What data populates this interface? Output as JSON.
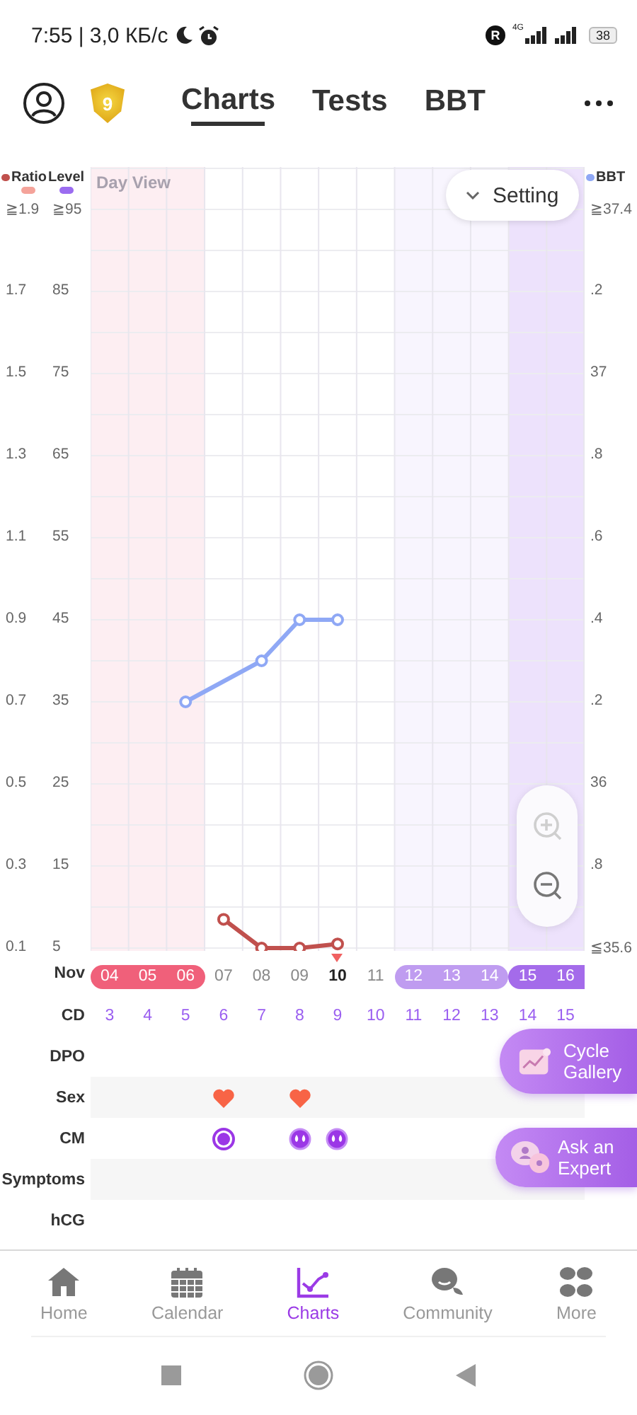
{
  "status_bar": {
    "time": "7:55 | 3,0 КБ/с",
    "indicator": "R",
    "network": "4G",
    "battery": "38"
  },
  "header": {
    "badge": "9",
    "tabs": [
      {
        "label": "Charts",
        "selected": true
      },
      {
        "label": "Tests",
        "selected": false
      },
      {
        "label": "BBT",
        "selected": false
      }
    ]
  },
  "legend": {
    "ratio_light": {
      "color": "#f4a39a"
    },
    "level": {
      "label": "Level",
      "color": "#9b6cf0"
    }
  },
  "chart": {
    "view_label": "Day View",
    "setting_button": "Setting",
    "zoom_in_disabled": true,
    "level_ticks": [
      "≧95",
      "85",
      "75",
      "65",
      "55",
      "45",
      "35",
      "25",
      "15",
      "5"
    ],
    "chart_data": {
      "type": "line",
      "grid": true,
      "legend": "top",
      "categories": [
        "04",
        "05",
        "06",
        "07",
        "08",
        "09",
        "10",
        "11",
        "12",
        "13",
        "14",
        "15",
        "16"
      ],
      "series": [
        {
          "name": "Ratio",
          "color": "#c0504d",
          "marker": "circle",
          "values": [
            null,
            null,
            null,
            0.17,
            0.1,
            0.1,
            0.11,
            null,
            null,
            null,
            null,
            null,
            null
          ]
        },
        {
          "name": "BBT",
          "color": "#8fa8f5",
          "marker": "circle",
          "axis": "y2",
          "values": [
            null,
            null,
            36.2,
            null,
            36.3,
            36.4,
            36.4,
            null,
            null,
            null,
            null,
            null,
            null
          ]
        }
      ],
      "ylim": [
        0.1,
        1.9
      ],
      "y2lim": [
        35.6,
        37.4
      ],
      "yticks": [
        {
          "value": 1.9,
          "label": "≧1.9"
        },
        {
          "value": 1.7,
          "label": "1.7"
        },
        {
          "value": 1.5,
          "label": "1.5"
        },
        {
          "value": 1.3,
          "label": "1.3"
        },
        {
          "value": 1.1,
          "label": "1.1"
        },
        {
          "value": 0.9,
          "label": "0.9"
        },
        {
          "value": 0.7,
          "label": "0.7"
        },
        {
          "value": 0.5,
          "label": "0.5"
        },
        {
          "value": 0.3,
          "label": "0.3"
        },
        {
          "value": 0.1,
          "label": "0.1"
        }
      ],
      "y2ticks": [
        {
          "value": 37.4,
          "label": "≧37.4"
        },
        {
          "value": 37.0,
          "label": "37"
        },
        {
          "value": 36.0,
          "label": "36"
        },
        {
          "value": 35.6,
          "label": "≦35.6"
        }
      ]
    },
    "bbt_decimal_labels": [
      ".2",
      ".8",
      ".6",
      ".4",
      ".2",
      ".8"
    ]
  },
  "month": "Nov",
  "days": [
    {
      "cd": "3",
      "kind": "period",
      "today": false
    },
    {
      "cd": "4",
      "kind": "period",
      "today": false
    },
    {
      "cd": "5",
      "kind": "period",
      "today": false
    },
    {
      "cd": "6",
      "kind": "normal",
      "today": false,
      "sex": true,
      "cm": {
        "kind": "dot"
      }
    },
    {
      "cd": "7",
      "kind": "normal",
      "today": false
    },
    {
      "cd": "8",
      "kind": "normal",
      "today": false,
      "sex": true,
      "cm": {
        "kind": "drops"
      }
    },
    {
      "cd": "9",
      "kind": "normal",
      "today": true,
      "cm": {
        "kind": "drops"
      }
    },
    {
      "cd": "10",
      "kind": "normal",
      "today": false
    },
    {
      "cd": "11",
      "kind": "fertile",
      "today": false
    },
    {
      "cd": "12",
      "kind": "fertile",
      "today": false
    },
    {
      "cd": "13",
      "kind": "fertile",
      "today": false
    },
    {
      "cd": "14",
      "kind": "ovulation",
      "today": false
    },
    {
      "cd": "15",
      "kind": "ovulation",
      "today": false
    }
  ],
  "rows": [
    {
      "label": "CD",
      "kind": "cd"
    },
    {
      "label": "DPO",
      "kind": "blank"
    },
    {
      "label": "Sex",
      "kind": "sex"
    },
    {
      "label": "CM",
      "kind": "cm"
    },
    {
      "label": "Symptoms",
      "kind": "blank"
    },
    {
      "label": "hCG",
      "kind": "blank"
    }
  ],
  "actions": [
    {
      "label": "Cycle Gallery",
      "kind": "gallery"
    },
    {
      "label": "Ask an Expert",
      "kind": "expert"
    }
  ],
  "nav": [
    {
      "label": "Home",
      "kind": "home",
      "selected": false
    },
    {
      "label": "Calendar",
      "kind": "calendar",
      "selected": false
    },
    {
      "label": "Charts",
      "kind": "charts",
      "selected": true
    },
    {
      "label": "Community",
      "kind": "community",
      "selected": false
    },
    {
      "label": "More",
      "kind": "more",
      "selected": false
    }
  ]
}
